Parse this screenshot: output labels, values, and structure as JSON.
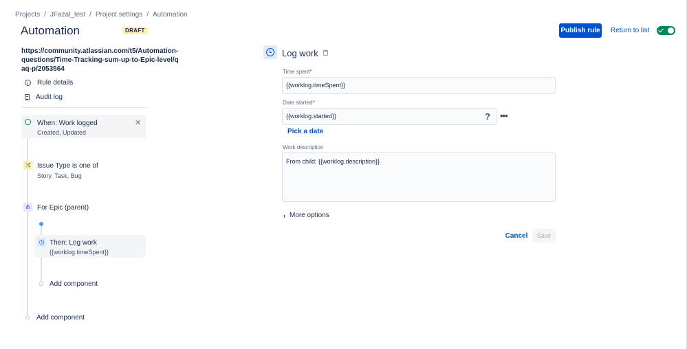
{
  "breadcrumb": [
    "Projects",
    "JFazal_test",
    "Project settings",
    "Automation"
  ],
  "header": {
    "title": "Automation",
    "badge": "DRAFT",
    "publish_label": "Publish rule",
    "return_label": "Return to list",
    "toggle_enabled": true
  },
  "sidebar": {
    "rule_name": "https://community.atlassian.com/t5/Automation-questions/Time-Tracking-sum-up-to-Epic-level/qaq-p/2053564",
    "links": [
      {
        "label": "Rule details",
        "icon": "info-icon"
      },
      {
        "label": "Audit log",
        "icon": "document-icon"
      }
    ]
  },
  "flow": {
    "trigger": {
      "title": "When: Work logged",
      "sub": "Created, Updated",
      "icon": "clock-icon",
      "color": "#00875a"
    },
    "condition": {
      "title": "Issue Type is one of",
      "sub": "Story, Task, Bug",
      "icon": "shuffle-icon",
      "color": "#fff0b3"
    },
    "branch": {
      "title": "For Epic (parent)",
      "icon": "hierarchy-icon",
      "color": "#eae6ff"
    },
    "action": {
      "title": "Then: Log work",
      "sub": "{{worklog.timeSpent}}",
      "icon": "clock-icon",
      "color": "#deebff"
    },
    "add_inner": "Add component",
    "add_outer": "Add component"
  },
  "panel": {
    "title": "Log work",
    "time_label": "Time spent",
    "time_value": "{{worklog.timeSpent}}",
    "date_label": "Date started",
    "date_value": "{{worklog.started}}",
    "help": "?",
    "more": "•••",
    "pick_date": "Pick a date",
    "desc_label": "Work description",
    "desc_value": "From child: {{worklog.description}}",
    "required_marker": "*",
    "more_options": "More options",
    "cancel_label": "Cancel",
    "save_label": "Save"
  },
  "colors": {
    "accent": "#0052cc",
    "toggle": "#00875a",
    "required": "#de350b"
  }
}
